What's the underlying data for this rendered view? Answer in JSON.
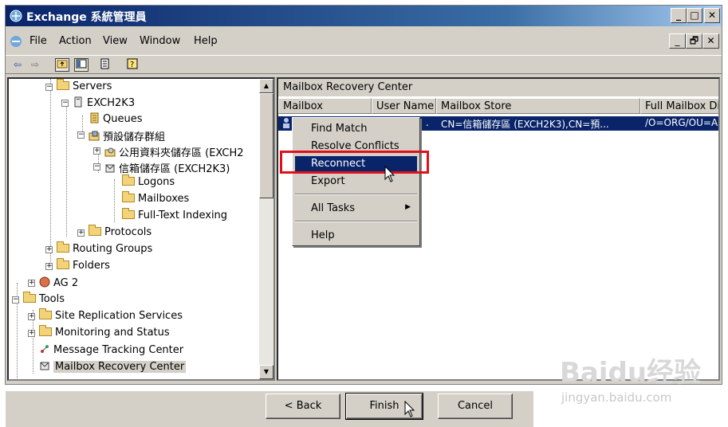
{
  "window": {
    "title": "Exchange 系統管理員",
    "caption_buttons": [
      "_",
      "□",
      "✕"
    ],
    "mdi_buttons": [
      "_",
      "🗗",
      "✕"
    ]
  },
  "menu": [
    {
      "label": "File"
    },
    {
      "label": "Action"
    },
    {
      "label": "View"
    },
    {
      "label": "Window"
    },
    {
      "label": "Help"
    }
  ],
  "toolbar": {
    "icons": [
      "back-arrow-icon",
      "forward-arrow-icon",
      "up-folder-icon",
      "show-hide-tree-icon",
      "export-list-icon",
      "help-icon"
    ]
  },
  "tree": {
    "servers": "Servers",
    "exch2k3": "EXCH2K3",
    "queues": "Queues",
    "storage_group": "預設儲存群組",
    "public_store": "公用資料夾儲存區 (EXCH2",
    "mailbox_store": "信箱儲存區 (EXCH2K3)",
    "logons": "Logons",
    "mailboxes": "Mailboxes",
    "fulltext": "Full-Text Indexing",
    "protocols": "Protocols",
    "routing_groups": "Routing Groups",
    "folders": "Folders",
    "ag2": "AG 2",
    "tools": "Tools",
    "site_replication": "Site Replication Services",
    "monitoring": "Monitoring and Status",
    "message_tracking": "Message Tracking Center",
    "mailbox_recovery": "Mailbox Recovery Center"
  },
  "right_pane": {
    "header": "Mailbox Recovery Center",
    "columns": [
      "Mailbox",
      "User Name",
      "Mailbox Store",
      "Full Mailbox Dire"
    ],
    "row": {
      "user_name": ".",
      "mailbox_store": "CN=信箱儲存區 (EXCH2K3),CN=預...",
      "full_dir": "/O=ORG/OU=A"
    }
  },
  "context_menu": {
    "items": [
      "Find Match",
      "Resolve Conflicts",
      "Reconnect",
      "Export",
      "All Tasks",
      "Help"
    ],
    "highlighted": "Reconnect"
  },
  "wizard_buttons": {
    "back": "< Back",
    "finish": "Finish",
    "cancel": "Cancel"
  },
  "watermark": {
    "logo": "Baidu经验",
    "url": "jingyan.baidu.com"
  },
  "colors": {
    "highlight": "#0a246a",
    "annotation_red": "#e0101a",
    "chrome": "#d4d0c8"
  }
}
